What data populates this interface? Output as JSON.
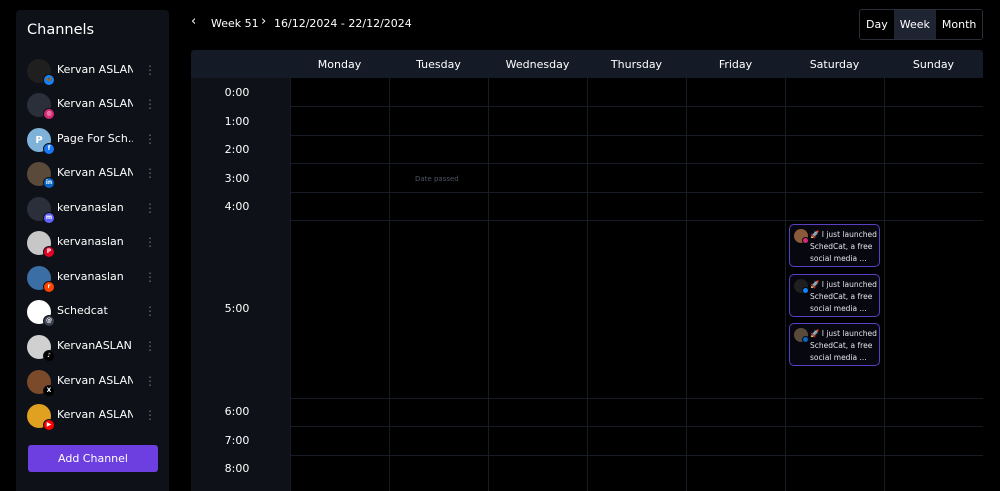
{
  "sidebar": {
    "title": "Channels",
    "add_channel_label": "Add Channel",
    "menu_glyph": "⋮",
    "channels": [
      {
        "name": "Kervan ASLAN",
        "platform": "bluesky",
        "avatar_color": "#1f1f1f",
        "badge_color": "#1185fe",
        "badge_glyph": "🦋"
      },
      {
        "name": "Kervan ASLAN",
        "platform": "instagram",
        "avatar_color": "#2b2f3a",
        "badge_color": "#d62976",
        "badge_glyph": "◎"
      },
      {
        "name": "Page For Sch...",
        "platform": "facebook",
        "avatar_color": "#7fb2d9",
        "avatar_letter": "P",
        "badge_color": "#1877f2",
        "badge_glyph": "f"
      },
      {
        "name": "Kervan ASLAN",
        "platform": "linkedin",
        "avatar_color": "#5a4a3a",
        "badge_color": "#0a66c2",
        "badge_glyph": "in"
      },
      {
        "name": "kervanaslan",
        "platform": "mastodon",
        "avatar_color": "#2b2f3a",
        "badge_color": "#6364ff",
        "badge_glyph": "m"
      },
      {
        "name": "kervanaslan",
        "platform": "pinterest",
        "avatar_color": "#c7c7c7",
        "badge_color": "#e60023",
        "badge_glyph": "P"
      },
      {
        "name": "kervanaslan",
        "platform": "reddit",
        "avatar_color": "#3a6ea5",
        "badge_color": "#ff4500",
        "badge_glyph": "r"
      },
      {
        "name": "Schedcat",
        "platform": "threads",
        "avatar_color": "#ffffff",
        "badge_color": "#3b4252",
        "badge_glyph": "@"
      },
      {
        "name": "KervanASLAN",
        "platform": "tiktok",
        "avatar_color": "#d0d0d0",
        "badge_color": "#000000",
        "badge_glyph": "♪"
      },
      {
        "name": "Kervan ASLAN",
        "platform": "x",
        "avatar_color": "#7a4a2a",
        "badge_color": "#000000",
        "badge_glyph": "X"
      },
      {
        "name": "Kervan ASLAN",
        "platform": "youtube",
        "avatar_color": "#e0a020",
        "badge_color": "#ff0000",
        "badge_glyph": "▶"
      }
    ]
  },
  "header": {
    "prev_glyph": "‹",
    "next_glyph": "›",
    "week_label": "Week 51",
    "date_range": "16/12/2024 - 22/12/2024",
    "views": [
      "Day",
      "Week",
      "Month"
    ],
    "active_view": "Week"
  },
  "calendar": {
    "days": [
      "Monday",
      "Tuesday",
      "Wednesday",
      "Thursday",
      "Friday",
      "Saturday",
      "Sunday"
    ],
    "times": [
      "0:00",
      "1:00",
      "2:00",
      "3:00",
      "4:00",
      "5:00",
      "6:00",
      "7:00",
      "8:00"
    ],
    "date_passed_label": "Date passed",
    "posts": [
      {
        "day": "Saturday",
        "time": "5:00",
        "platform": "instagram",
        "avatar_color": "#8a5a3a",
        "badge_color": "#d62976",
        "line1": "🚀 I just launched",
        "line2": "SchedCat, a free",
        "line3": "social media ..."
      },
      {
        "day": "Saturday",
        "time": "5:00",
        "platform": "bluesky",
        "avatar_color": "#1f1f1f",
        "badge_color": "#1185fe",
        "line1": "🚀 I just launched",
        "line2": "SchedCat, a free",
        "line3": "social media ..."
      },
      {
        "day": "Saturday",
        "time": "5:00",
        "platform": "linkedin",
        "avatar_color": "#5a4a3a",
        "badge_color": "#0a66c2",
        "line1": "🚀 I just launched",
        "line2": "SchedCat, a free",
        "line3": "social media ..."
      }
    ]
  },
  "colors": {
    "accent": "#6d3fe0",
    "post_border": "#5b3fc4",
    "header_bg": "#141a26",
    "sidebar_bg": "#0e1117"
  }
}
